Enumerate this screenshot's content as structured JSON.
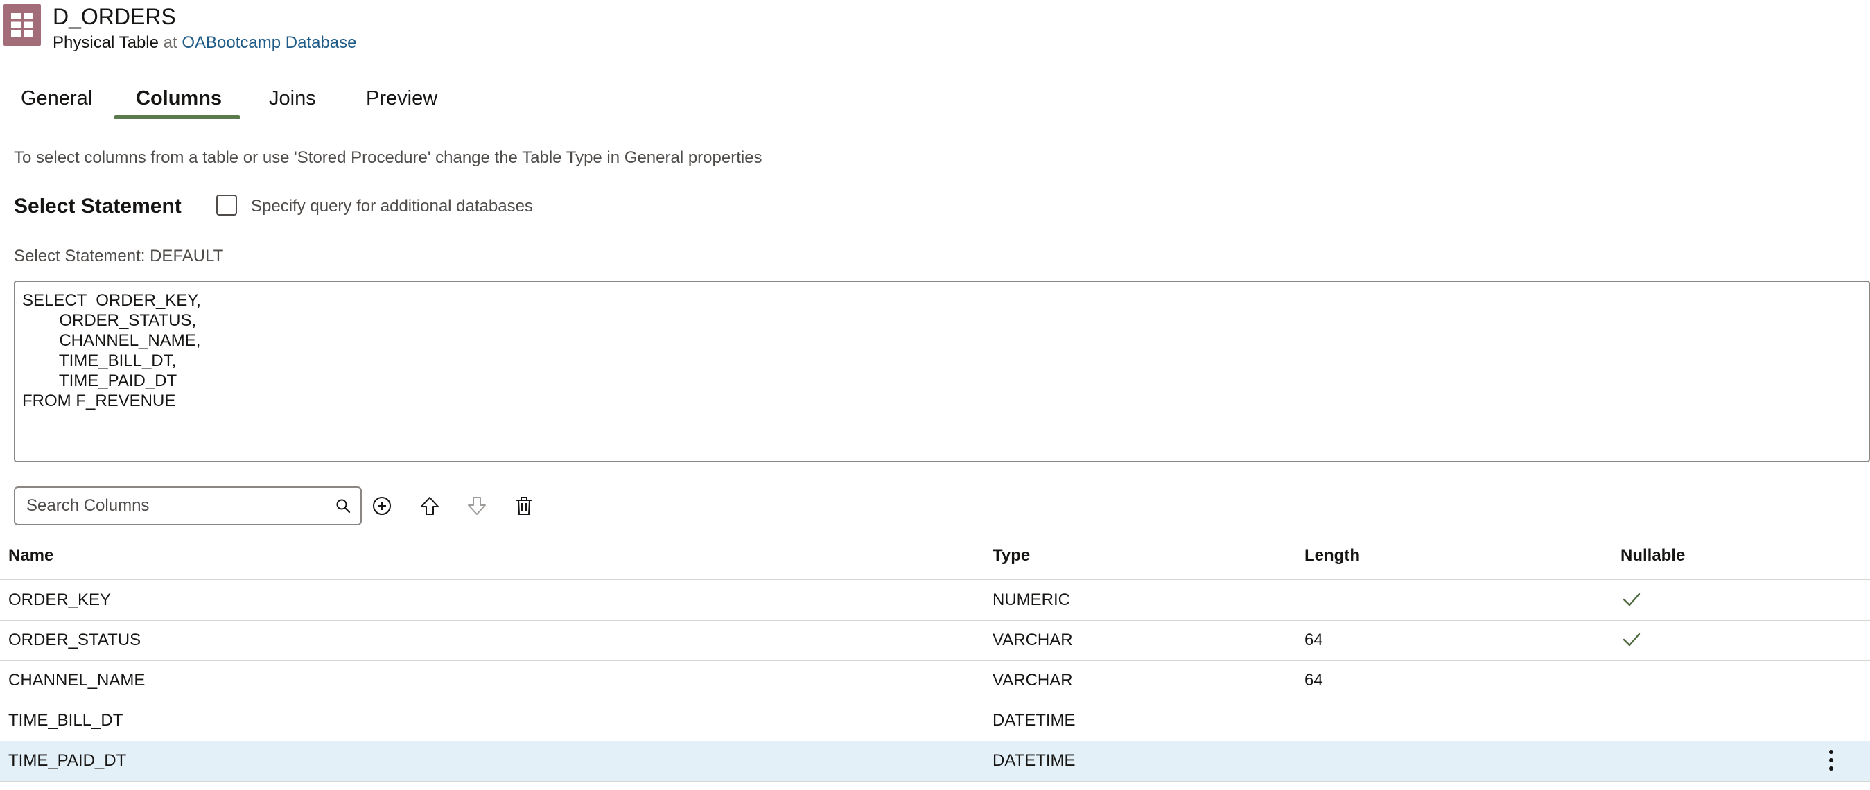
{
  "header": {
    "title": "D_ORDERS",
    "object_type": "Physical Table",
    "connector": "at",
    "database_link": "OABootcamp Database",
    "icon": "table-grid-icon",
    "icon_color": "#a26c78"
  },
  "tabs": [
    {
      "label": "General",
      "active": false
    },
    {
      "label": "Columns",
      "active": true
    },
    {
      "label": "Joins",
      "active": false
    },
    {
      "label": "Preview",
      "active": false
    }
  ],
  "info_text": "To select columns from a table or use 'Stored Procedure' change the Table Type in General properties",
  "select_statement": {
    "heading": "Select Statement",
    "checkbox_label": "Specify query for additional databases",
    "checkbox_checked": false,
    "statement_label": "Select Statement: DEFAULT",
    "sql": "SELECT  ORDER_KEY,\n        ORDER_STATUS,\n        CHANNEL_NAME,\n        TIME_BILL_DT,\n        TIME_PAID_DT\nFROM F_REVENUE"
  },
  "toolbar": {
    "search_placeholder": "Search Columns",
    "search_value": "",
    "icons": [
      "search-icon",
      "add-circle-icon",
      "move-up-icon",
      "move-down-icon",
      "delete-icon"
    ]
  },
  "table": {
    "headers": {
      "name": "Name",
      "type": "Type",
      "length": "Length",
      "nullable": "Nullable"
    },
    "rows": [
      {
        "name": "ORDER_KEY",
        "type": "NUMERIC",
        "length": "",
        "nullable": true,
        "selected": false
      },
      {
        "name": "ORDER_STATUS",
        "type": "VARCHAR",
        "length": "64",
        "nullable": true,
        "selected": false
      },
      {
        "name": "CHANNEL_NAME",
        "type": "VARCHAR",
        "length": "64",
        "nullable": false,
        "selected": false
      },
      {
        "name": "TIME_BILL_DT",
        "type": "DATETIME",
        "length": "",
        "nullable": false,
        "selected": false
      },
      {
        "name": "TIME_PAID_DT",
        "type": "DATETIME",
        "length": "",
        "nullable": false,
        "selected": true
      }
    ]
  },
  "colors": {
    "accent_tab": "#5a7a4c",
    "link": "#1f5b87",
    "selected_row": "#e4f0f8",
    "check": "#4f6b3f"
  }
}
